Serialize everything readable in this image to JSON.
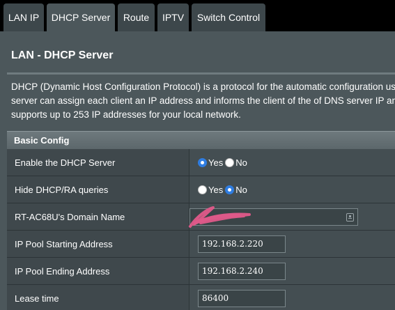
{
  "tabs": [
    {
      "label": "LAN IP"
    },
    {
      "label": "DHCP Server"
    },
    {
      "label": "Route"
    },
    {
      "label": "IPTV"
    },
    {
      "label": "Switch Control"
    }
  ],
  "page": {
    "title": "LAN - DHCP Server",
    "description_lines": [
      "DHCP (Dynamic Host Configuration Protocol) is a protocol for the automatic configuration used o",
      "server can assign each client an IP address and informs the client of the of DNS server IP and d",
      "supports up to 253 IP addresses for your local network."
    ]
  },
  "basic_config": {
    "header": "Basic Config",
    "enable_dhcp": {
      "label": "Enable the DHCP Server",
      "yes": "Yes",
      "no": "No",
      "selected": "Yes"
    },
    "hide_queries": {
      "label": "Hide DHCP/RA queries",
      "yes": "Yes",
      "no": "No",
      "selected": "No"
    },
    "domain_name": {
      "label": "RT-AC68U's Domain Name",
      "value": ""
    },
    "pool_start": {
      "label": "IP Pool Starting Address",
      "value": "192.168.2.220"
    },
    "pool_end": {
      "label": "IP Pool Ending Address",
      "value": "192.168.2.240"
    },
    "lease_time": {
      "label": "Lease time",
      "value": "86400"
    }
  },
  "colors": {
    "background": "#000000",
    "panel": "#4c575b",
    "radio_selected": "#2f7de1",
    "redaction_scribble": "#e05a8a"
  }
}
